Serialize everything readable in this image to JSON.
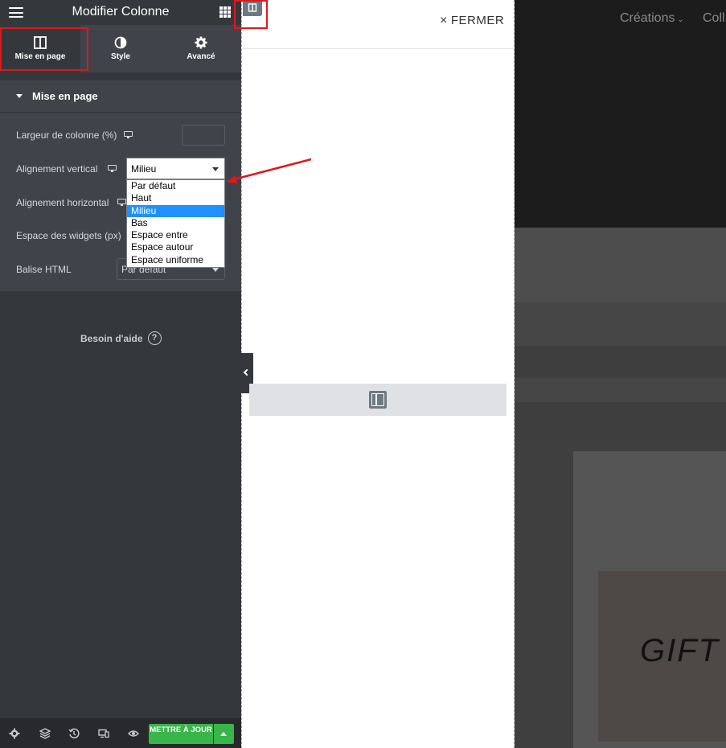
{
  "panel": {
    "title": "Modifier Colonne",
    "tabs": [
      {
        "label": "Mise en page",
        "icon": "columns-icon",
        "active": true
      },
      {
        "label": "Style",
        "icon": "half-circle-icon",
        "active": false
      },
      {
        "label": "Avancé",
        "icon": "gear-icon",
        "active": false
      }
    ],
    "section_title": "Mise en page",
    "controls": {
      "column_width_label": "Largeur de colonne (%)",
      "vertical_align_label": "Alignement vertical",
      "vertical_align_value": "Milieu",
      "horizontal_align_label": "Alignement horizontal",
      "widget_gap_label": "Espace des widgets (px)",
      "html_tag_label": "Balise HTML",
      "html_tag_value": "Par défaut"
    },
    "dropdown_options": [
      "Par défaut",
      "Haut",
      "Milieu",
      "Bas",
      "Espace entre",
      "Espace autour",
      "Espace uniforme"
    ],
    "dropdown_selected": "Milieu",
    "help_label": "Besoin d'aide",
    "help_icon": "?",
    "update_label": "METTRE À JOUR"
  },
  "middle": {
    "close_label": "FERMER",
    "close_icon": "×"
  },
  "right": {
    "nav_creations": "Créations",
    "nav_coll": "Coll",
    "gift_text": "GIFT C"
  },
  "colors": {
    "panel_bg": "#34383c",
    "accent_green": "#39b54a",
    "highlight_red": "#e0171d",
    "selected_blue": "#1e90ff"
  }
}
